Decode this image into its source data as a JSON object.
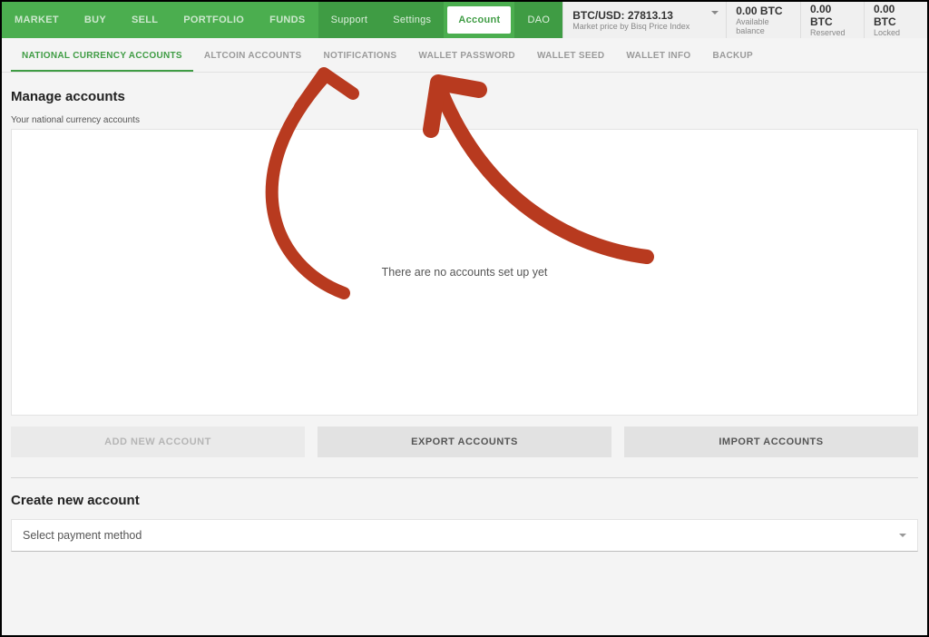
{
  "nav": {
    "market": "MARKET",
    "buy": "BUY",
    "sell": "SELL",
    "portfolio": "PORTFOLIO",
    "funds": "FUNDS",
    "support": "Support",
    "settings": "Settings",
    "account": "Account",
    "dao": "DAO"
  },
  "status": {
    "price_label": "BTC/USD: 27813.13",
    "price_sub": "Market price by Bisq Price Index",
    "avail_main": "0.00 BTC",
    "avail_sub": "Available balance",
    "reserved_main": "0.00 BTC",
    "reserved_sub": "Reserved",
    "locked_main": "0.00 BTC",
    "locked_sub": "Locked"
  },
  "subtabs": {
    "national": "NATIONAL CURRENCY ACCOUNTS",
    "altcoin": "ALTCOIN ACCOUNTS",
    "notifications": "NOTIFICATIONS",
    "wallet_password": "WALLET PASSWORD",
    "wallet_seed": "WALLET SEED",
    "wallet_info": "WALLET INFO",
    "backup": "BACKUP"
  },
  "manage": {
    "title": "Manage accounts",
    "list_label": "Your national currency accounts",
    "empty": "There are no accounts set up yet",
    "add_btn": "ADD NEW ACCOUNT",
    "export_btn": "EXPORT ACCOUNTS",
    "import_btn": "IMPORT ACCOUNTS"
  },
  "create": {
    "title": "Create new account",
    "select_placeholder": "Select payment method"
  }
}
